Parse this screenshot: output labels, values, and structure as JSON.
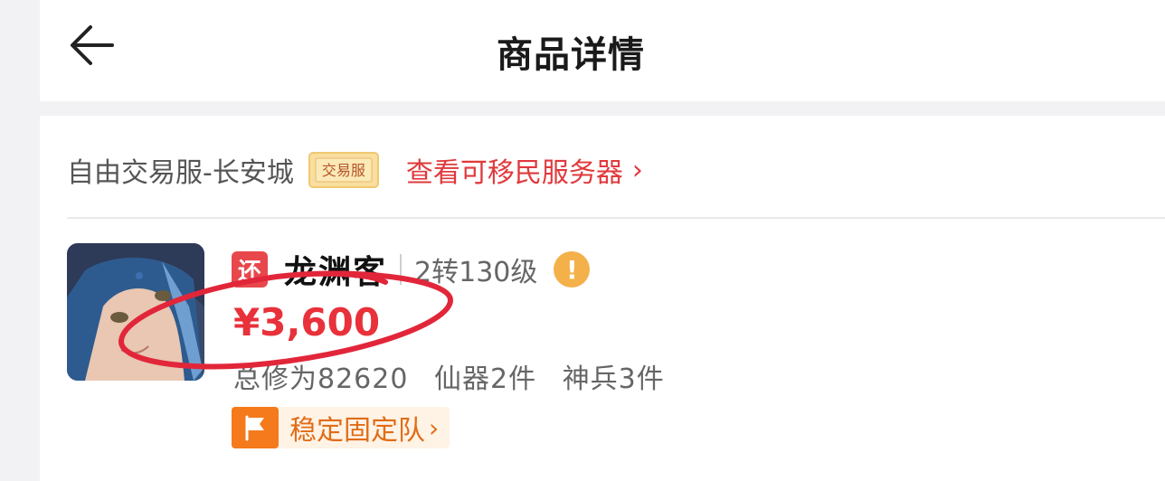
{
  "header": {
    "title": "商品详情",
    "back_icon": "arrow-left-icon"
  },
  "server": {
    "name": "自由交易服-长安城",
    "badge_text": "交易服",
    "migrate_link": "查看可移民服务器",
    "chevron": "›"
  },
  "character": {
    "tag": "还",
    "name": "龙渊客",
    "level": "2转130级",
    "warning_icon": "!",
    "price": "¥3,600",
    "stats": [
      "总修为82620",
      "仙器2件",
      "神兵3件"
    ],
    "team_label": "稳定固定队",
    "team_chevron": "›"
  },
  "colors": {
    "accent_red": "#e8313a",
    "orange": "#f47a1c",
    "warning": "#f4b14a"
  }
}
